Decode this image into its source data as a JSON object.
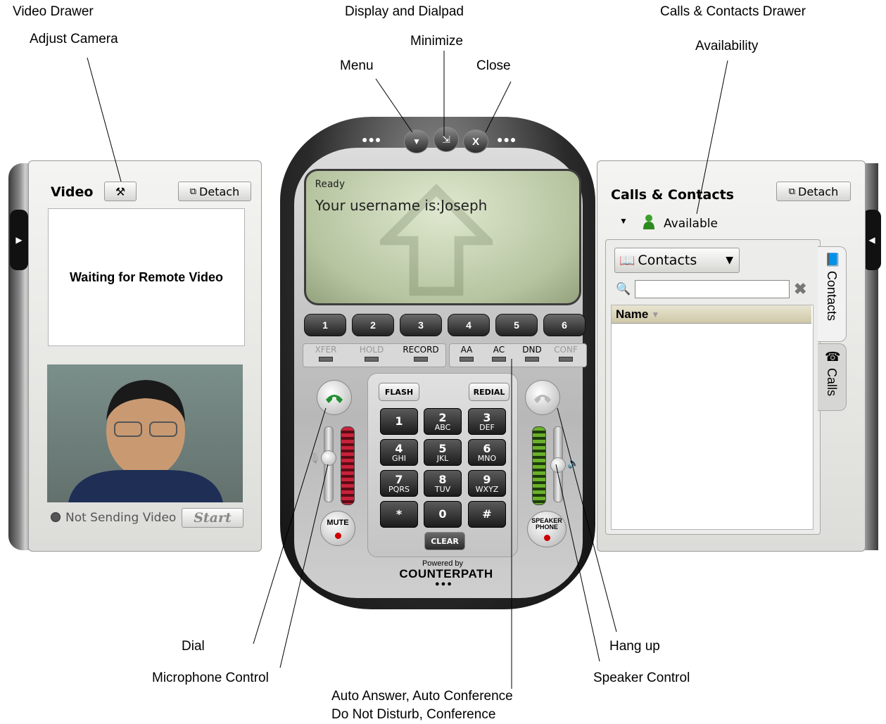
{
  "callouts": {
    "video_drawer": "Video Drawer",
    "adjust_camera": "Adjust Camera",
    "display_dialpad": "Display and Dialpad",
    "minimize": "Minimize",
    "menu": "Menu",
    "close": "Close",
    "calls_contacts_drawer": "Calls & Contacts Drawer",
    "availability": "Availability",
    "dial": "Dial",
    "microphone_control": "Microphone Control",
    "auto_line1": "Auto Answer, Auto Conference",
    "auto_line2": "Do Not Disturb, Conference",
    "hang_up": "Hang up",
    "speaker_control": "Speaker Control"
  },
  "video": {
    "title": "Video",
    "detach": "Detach",
    "waiting": "Waiting for Remote Video",
    "not_sending": "Not Sending Video",
    "start": "Start"
  },
  "display": {
    "status": "Ready",
    "message": "Your username is:Joseph"
  },
  "lines": [
    "1",
    "2",
    "3",
    "4",
    "5",
    "6"
  ],
  "features_left": [
    "XFER",
    "HOLD",
    "RECORD"
  ],
  "features_right": [
    "AA",
    "AC",
    "DND",
    "CONF"
  ],
  "dialpad": {
    "flash": "FLASH",
    "redial": "REDIAL",
    "clear": "CLEAR",
    "keys": [
      {
        "d": "1",
        "l": ""
      },
      {
        "d": "2",
        "l": "ABC"
      },
      {
        "d": "3",
        "l": "DEF"
      },
      {
        "d": "4",
        "l": "GHI"
      },
      {
        "d": "5",
        "l": "JKL"
      },
      {
        "d": "6",
        "l": "MNO"
      },
      {
        "d": "7",
        "l": "PQRS"
      },
      {
        "d": "8",
        "l": "TUV"
      },
      {
        "d": "9",
        "l": "WXYZ"
      },
      {
        "d": "*",
        "l": ""
      },
      {
        "d": "0",
        "l": ""
      },
      {
        "d": "#",
        "l": ""
      }
    ]
  },
  "controls": {
    "mute": "MUTE",
    "speaker_line1": "SPEAKER",
    "speaker_line2": "PHONE"
  },
  "branding": {
    "powered_by": "Powered by",
    "brand": "COUNTERPATH"
  },
  "contacts_drawer": {
    "title": "Calls & Contacts",
    "detach": "Detach",
    "availability": "Available",
    "dropdown": "Contacts",
    "column_name": "Name",
    "tab_contacts": "Contacts",
    "tab_calls": "Calls"
  }
}
